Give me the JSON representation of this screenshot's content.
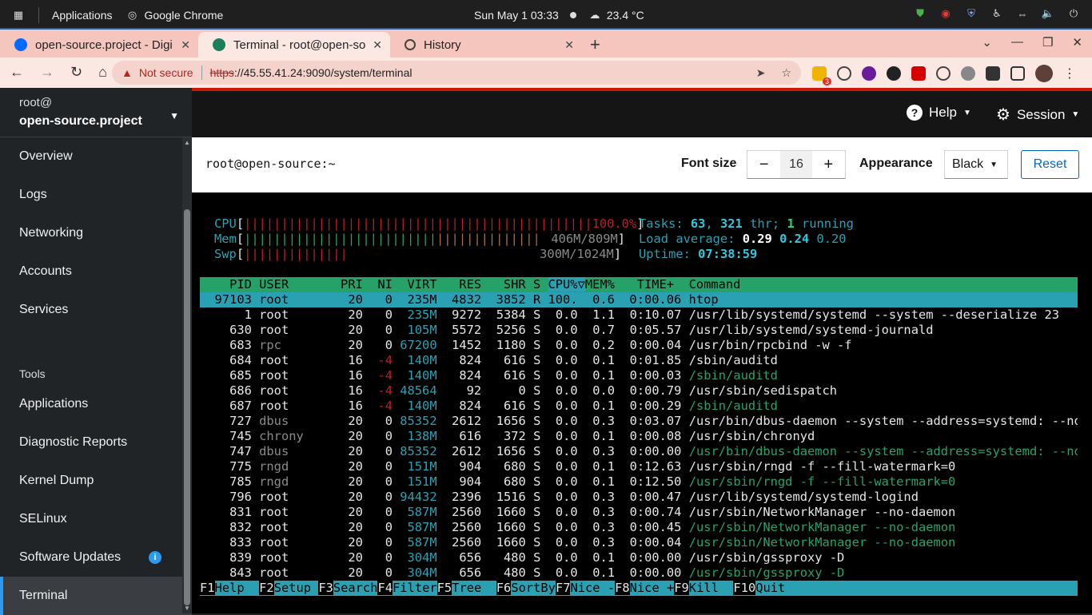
{
  "os": {
    "applications_label": "Applications",
    "active_app": "Google Chrome",
    "clock": "Sun May 1  03:33",
    "weather": "23.4 °C"
  },
  "browser": {
    "tabs": [
      {
        "title": "open-source.project - Digi",
        "active": false
      },
      {
        "title": "Terminal - root@open-sou",
        "active": true
      },
      {
        "title": "History",
        "active": false
      }
    ],
    "security_label": "Not secure",
    "url_scheme": "https",
    "url_rest": "://45.55.41.24:9090/system/terminal",
    "ext_badge": "3"
  },
  "sidebar": {
    "user": "root@",
    "host": "open-source.project",
    "items": [
      {
        "label": "Overview"
      },
      {
        "label": "Logs"
      },
      {
        "label": "Networking"
      },
      {
        "label": "Accounts"
      },
      {
        "label": "Services"
      }
    ],
    "tools_heading": "Tools",
    "tools": [
      {
        "label": "Applications"
      },
      {
        "label": "Diagnostic Reports"
      },
      {
        "label": "Kernel Dump"
      },
      {
        "label": "SELinux"
      },
      {
        "label": "Software Updates"
      },
      {
        "label": "Terminal"
      }
    ]
  },
  "topbar": {
    "help": "Help",
    "session": "Session"
  },
  "terminal_header": {
    "prompt": "root@open-source:~",
    "font_size_label": "Font size",
    "font_size_value": "16",
    "appearance_label": "Appearance",
    "appearance_value": "Black",
    "reset_label": "Reset"
  },
  "htop": {
    "cpu_label": "CPU",
    "cpu_value": "100.0%",
    "mem_label": "Mem",
    "mem_value": "406M/809M",
    "swp_label": "Swp",
    "swp_value": "300M/1024M",
    "tasks_label": "Tasks:",
    "tasks_count": "63",
    "thr_count": "321",
    "thr_label": "thr;",
    "running_count": "1",
    "running_label": "running",
    "load_label": "Load average:",
    "load1": "0.29",
    "load5": "0.24",
    "load15": "0.20",
    "uptime_label": "Uptime:",
    "uptime_value": "07:38:59",
    "columns": "    PID USER       PRI  NI  VIRT   RES   SHR S ",
    "col_cpu": "CPU%▽",
    "col_rest": "MEM%   TIME+  Command",
    "selected": "  97103 root        20   0  235M  4832  3852 R 100.  0.6  0:00.06 htop",
    "processes": [
      {
        "pid": "1",
        "user": "root",
        "pri": "20",
        "ni": "0",
        "virt": "235M",
        "res": "9272",
        "shr": "5384",
        "s": "S",
        "cpu": "0.0",
        "mem": "1.1",
        "time": "0:10.07",
        "cmd": "/usr/lib/systemd/systemd --system --deserialize 23",
        "thread": false
      },
      {
        "pid": "630",
        "user": "root",
        "pri": "20",
        "ni": "0",
        "virt": "105M",
        "res": "5572",
        "shr": "5256",
        "s": "S",
        "cpu": "0.0",
        "mem": "0.7",
        "time": "0:05.57",
        "cmd": "/usr/lib/systemd/systemd-journald",
        "thread": false
      },
      {
        "pid": "683",
        "user": "rpc",
        "pri": "20",
        "ni": "0",
        "virt": "67200",
        "res": "1452",
        "shr": "1180",
        "s": "S",
        "cpu": "0.0",
        "mem": "0.2",
        "time": "0:00.04",
        "cmd": "/usr/bin/rpcbind -w -f",
        "thread": false
      },
      {
        "pid": "684",
        "user": "root",
        "pri": "16",
        "ni": "-4",
        "virt": "140M",
        "res": "824",
        "shr": "616",
        "s": "S",
        "cpu": "0.0",
        "mem": "0.1",
        "time": "0:01.85",
        "cmd": "/sbin/auditd",
        "thread": false
      },
      {
        "pid": "685",
        "user": "root",
        "pri": "16",
        "ni": "-4",
        "virt": "140M",
        "res": "824",
        "shr": "616",
        "s": "S",
        "cpu": "0.0",
        "mem": "0.1",
        "time": "0:00.03",
        "cmd": "/sbin/auditd",
        "thread": true
      },
      {
        "pid": "686",
        "user": "root",
        "pri": "16",
        "ni": "-4",
        "virt": "48564",
        "res": "92",
        "shr": "0",
        "s": "S",
        "cpu": "0.0",
        "mem": "0.0",
        "time": "0:00.79",
        "cmd": "/usr/sbin/sedispatch",
        "thread": false
      },
      {
        "pid": "687",
        "user": "root",
        "pri": "16",
        "ni": "-4",
        "virt": "140M",
        "res": "824",
        "shr": "616",
        "s": "S",
        "cpu": "0.0",
        "mem": "0.1",
        "time": "0:00.29",
        "cmd": "/sbin/auditd",
        "thread": true
      },
      {
        "pid": "727",
        "user": "dbus",
        "pri": "20",
        "ni": "0",
        "virt": "85352",
        "res": "2612",
        "shr": "1656",
        "s": "S",
        "cpu": "0.0",
        "mem": "0.3",
        "time": "0:03.07",
        "cmd": "/usr/bin/dbus-daemon --system --address=systemd: --nofork",
        "thread": false
      },
      {
        "pid": "745",
        "user": "chrony",
        "pri": "20",
        "ni": "0",
        "virt": "138M",
        "res": "616",
        "shr": "372",
        "s": "S",
        "cpu": "0.0",
        "mem": "0.1",
        "time": "0:00.08",
        "cmd": "/usr/sbin/chronyd",
        "thread": false
      },
      {
        "pid": "747",
        "user": "dbus",
        "pri": "20",
        "ni": "0",
        "virt": "85352",
        "res": "2612",
        "shr": "1656",
        "s": "S",
        "cpu": "0.0",
        "mem": "0.3",
        "time": "0:00.00",
        "cmd": "/usr/bin/dbus-daemon --system --address=systemd: --nofork",
        "thread": true
      },
      {
        "pid": "775",
        "user": "rngd",
        "pri": "20",
        "ni": "0",
        "virt": "151M",
        "res": "904",
        "shr": "680",
        "s": "S",
        "cpu": "0.0",
        "mem": "0.1",
        "time": "0:12.63",
        "cmd": "/usr/sbin/rngd -f --fill-watermark=0",
        "thread": false
      },
      {
        "pid": "785",
        "user": "rngd",
        "pri": "20",
        "ni": "0",
        "virt": "151M",
        "res": "904",
        "shr": "680",
        "s": "S",
        "cpu": "0.0",
        "mem": "0.1",
        "time": "0:12.50",
        "cmd": "/usr/sbin/rngd -f --fill-watermark=0",
        "thread": true
      },
      {
        "pid": "796",
        "user": "root",
        "pri": "20",
        "ni": "0",
        "virt": "94432",
        "res": "2396",
        "shr": "1516",
        "s": "S",
        "cpu": "0.0",
        "mem": "0.3",
        "time": "0:00.47",
        "cmd": "/usr/lib/systemd/systemd-logind",
        "thread": false
      },
      {
        "pid": "831",
        "user": "root",
        "pri": "20",
        "ni": "0",
        "virt": "587M",
        "res": "2560",
        "shr": "1660",
        "s": "S",
        "cpu": "0.0",
        "mem": "0.3",
        "time": "0:00.74",
        "cmd": "/usr/sbin/NetworkManager --no-daemon",
        "thread": false
      },
      {
        "pid": "832",
        "user": "root",
        "pri": "20",
        "ni": "0",
        "virt": "587M",
        "res": "2560",
        "shr": "1660",
        "s": "S",
        "cpu": "0.0",
        "mem": "0.3",
        "time": "0:00.45",
        "cmd": "/usr/sbin/NetworkManager --no-daemon",
        "thread": true
      },
      {
        "pid": "833",
        "user": "root",
        "pri": "20",
        "ni": "0",
        "virt": "587M",
        "res": "2560",
        "shr": "1660",
        "s": "S",
        "cpu": "0.0",
        "mem": "0.3",
        "time": "0:00.04",
        "cmd": "/usr/sbin/NetworkManager --no-daemon",
        "thread": true
      },
      {
        "pid": "839",
        "user": "root",
        "pri": "20",
        "ni": "0",
        "virt": "304M",
        "res": "656",
        "shr": "480",
        "s": "S",
        "cpu": "0.0",
        "mem": "0.1",
        "time": "0:00.00",
        "cmd": "/usr/sbin/gssproxy -D",
        "thread": false
      },
      {
        "pid": "843",
        "user": "root",
        "pri": "20",
        "ni": "0",
        "virt": "304M",
        "res": "656",
        "shr": "480",
        "s": "S",
        "cpu": "0.0",
        "mem": "0.1",
        "time": "0:00.00",
        "cmd": "/usr/sbin/gssproxy -D",
        "thread": true
      }
    ],
    "fkeys": [
      {
        "key": "F1",
        "label": "Help  "
      },
      {
        "key": "F2",
        "label": "Setup "
      },
      {
        "key": "F3",
        "label": "Search"
      },
      {
        "key": "F4",
        "label": "Filter"
      },
      {
        "key": "F5",
        "label": "Tree  "
      },
      {
        "key": "F6",
        "label": "SortBy"
      },
      {
        "key": "F7",
        "label": "Nice -"
      },
      {
        "key": "F8",
        "label": "Nice +"
      },
      {
        "key": "F9",
        "label": "Kill  "
      },
      {
        "key": "F10",
        "label": "Quit"
      }
    ]
  },
  "colors": {
    "os_accent": "#2a5fae",
    "tabstrip": "#f5c6bd",
    "sidebar_bg": "#212427",
    "cockpit_red": "#c9190b",
    "link_blue": "#0066cc",
    "htop_green": "#26a269",
    "htop_cyan": "#2aa1b3"
  }
}
